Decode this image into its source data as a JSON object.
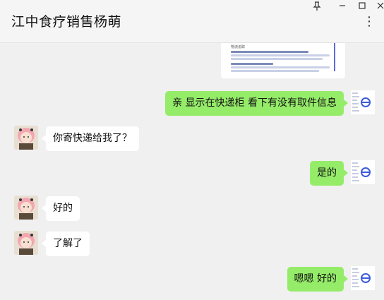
{
  "window": {
    "title": "江中食疗销售杨萌",
    "pin_icon": "pin-icon",
    "minimize_icon": "minimize-icon",
    "maximize_icon": "maximize-icon",
    "close_icon": "close-icon",
    "more_icon": "more-icon"
  },
  "messages": [
    {
      "sender": "me",
      "type": "image",
      "image_title": "物流追踪"
    },
    {
      "sender": "me",
      "text": "亲 显示在快递柜 看下有没有取件信息"
    },
    {
      "sender": "other",
      "text": "你寄快递给我了？"
    },
    {
      "sender": "me",
      "text": "是的"
    },
    {
      "sender": "other",
      "text": "好的"
    },
    {
      "sender": "other",
      "text": "了解了"
    },
    {
      "sender": "me",
      "text": "嗯嗯 好的"
    }
  ]
}
